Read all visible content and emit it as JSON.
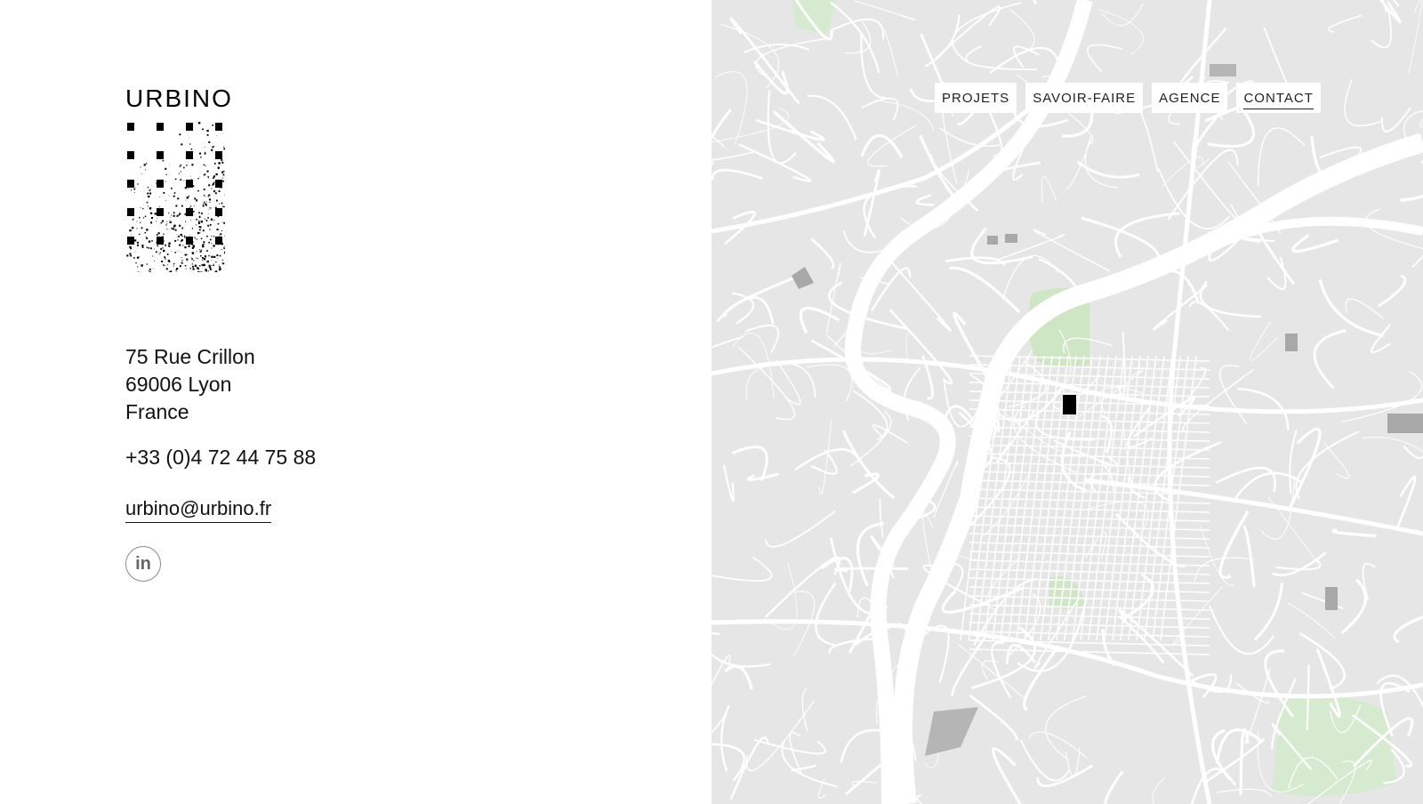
{
  "brand": {
    "logo_text": "URBINO"
  },
  "contact": {
    "address_line1": "75 Rue Crillon",
    "address_line2": "69006 Lyon",
    "address_line3": "France",
    "phone": "+33 (0)4 72 44 75 88",
    "email": "urbino@urbino.fr"
  },
  "social": {
    "linkedin_icon": "linkedin-icon",
    "linkedin_glyph": "in"
  },
  "nav": {
    "items": [
      {
        "label": "PROJETS"
      },
      {
        "label": "SAVOIR-FAIRE"
      },
      {
        "label": "AGENCE"
      },
      {
        "label": "CONTACT"
      }
    ],
    "active": "CONTACT"
  },
  "map": {
    "land_color": "#e6e6e6",
    "road_color": "#ffffff",
    "park_color": "#cfe6c4",
    "building_color": "#a8a8a8",
    "marker_color": "#000000"
  }
}
